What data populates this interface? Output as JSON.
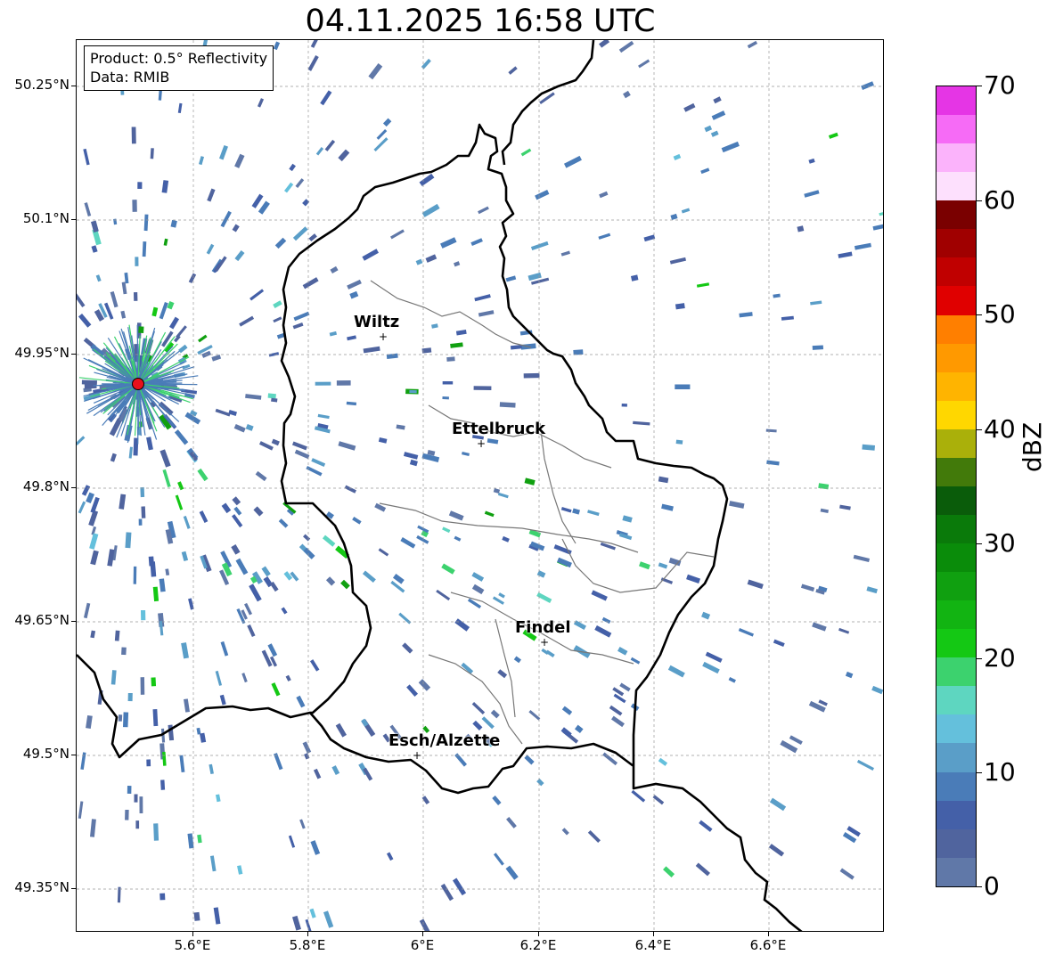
{
  "title": "04.11.2025 16:58 UTC",
  "info": {
    "product": "Product: 0.5° Reflectivity",
    "data_source": "Data: RMIB"
  },
  "axes": {
    "lat_ticks": [
      "50.25°N",
      "50.1°N",
      "49.95°N",
      "49.8°N",
      "49.65°N",
      "49.5°N",
      "49.35°N"
    ],
    "lon_ticks": [
      "5.6°E",
      "5.8°E",
      "6°E",
      "6.2°E",
      "6.4°E",
      "6.6°E"
    ]
  },
  "cities": [
    {
      "name": "Wiltz"
    },
    {
      "name": "Ettelbruck"
    },
    {
      "name": "Findel"
    },
    {
      "name": "Esch/Alzette"
    }
  ],
  "colorbar": {
    "unit": "dBZ",
    "tick_labels": [
      "70",
      "60",
      "50",
      "40",
      "30",
      "20",
      "10",
      "0"
    ],
    "colors_top_to_bottom": [
      "#e535e5",
      "#f66bf6",
      "#fbb3fb",
      "#fde0fd",
      "#7a0000",
      "#a00000",
      "#c00000",
      "#e00000",
      "#ff7f00",
      "#ff9900",
      "#ffb400",
      "#ffd700",
      "#aab00a",
      "#427a0a",
      "#0a5c0a",
      "#0a7a0a",
      "#0a8c0a",
      "#10a010",
      "#12b412",
      "#14c814",
      "#3cd26e",
      "#5ed6c0",
      "#64c0dc",
      "#5a9ec8",
      "#4a7cb8",
      "#4460a8",
      "#50649e",
      "#6078a8"
    ]
  },
  "radar_site": {
    "label": ""
  }
}
